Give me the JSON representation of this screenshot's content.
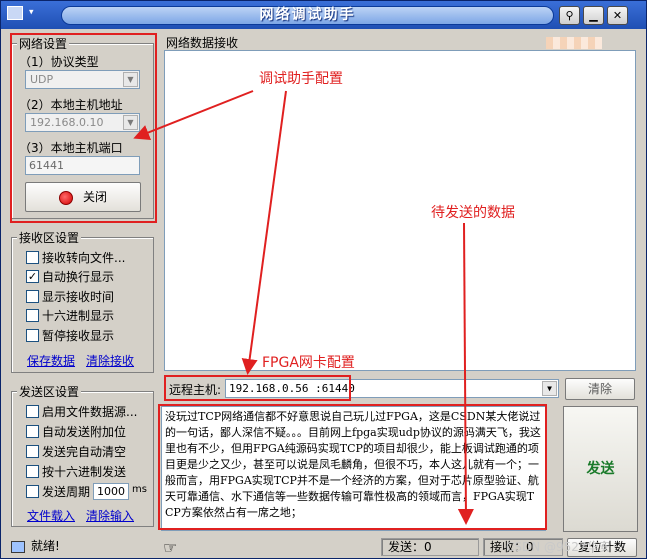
{
  "window": {
    "title": "网络调试助手",
    "pin_glyph": "⚲",
    "min_glyph": "▁",
    "close_glyph": "✕",
    "sysmenu_glyph": "▾"
  },
  "network_settings": {
    "title": "网络设置",
    "protocol_label": "（1）协议类型",
    "protocol_value": "UDP",
    "host_ip_label": "（2）本地主机地址",
    "host_ip_value": "192.168.0.10",
    "host_port_label": "（3）本地主机端口",
    "host_port_value": "61441",
    "close_button": "关闭"
  },
  "receive_settings": {
    "title": "接收区设置",
    "options": [
      {
        "label": "接收转向文件...",
        "checked": false
      },
      {
        "label": "自动换行显示",
        "checked": true
      },
      {
        "label": "显示接收时间",
        "checked": false
      },
      {
        "label": "十六进制显示",
        "checked": false
      },
      {
        "label": "暂停接收显示",
        "checked": false
      }
    ],
    "save_link": "保存数据",
    "clear_link": "清除接收"
  },
  "send_settings": {
    "title": "发送区设置",
    "options": [
      {
        "label": "启用文件数据源...",
        "checked": false
      },
      {
        "label": "自动发送附加位",
        "checked": false
      },
      {
        "label": "发送完自动清空",
        "checked": false
      },
      {
        "label": "按十六进制发送",
        "checked": false
      },
      {
        "label": "发送周期",
        "checked": false
      }
    ],
    "period_value": "1000",
    "period_unit": "ms",
    "load_link": "文件载入",
    "clear_link": "清除输入"
  },
  "receive_area": {
    "title": "网络数据接收"
  },
  "remote": {
    "label": "远程主机:",
    "value": "192.168.0.56 :61440",
    "clear_button": "清除"
  },
  "send_area": {
    "text": "没玩过TCP网络通信都不好意思说自己玩儿过FPGA，这是CSDN某大佬说过的一句话，鄙人深信不疑。。。目前网上fpga实现udp协议的源码满天飞，我这里也有不少，但用FPGA纯源码实现TCP的项目却很少，能上板调试跑通的项目更是少之又少，甚至可以说是凤毛麟角，但很不巧，本人这儿就有一个；一般而言，用FPGA实现TCP并不是一个经济的方案，但对于芯片原型验证、航天可靠通信、水下通信等一些数据传输可靠性极高的领域而言，FPGA实现TCP方案依然占有一席之地；",
    "send_button": "发送"
  },
  "status": {
    "ready": "就绪!",
    "sent": "发送：0",
    "received": "接收：0",
    "reset_button": "复位计数"
  },
  "annotations": {
    "config_note": "调试助手配置",
    "data_note": "待发送的数据",
    "fpga_note": "FPGA网卡配置",
    "color": "#e02020"
  },
  "watermark": "CSDN @9527华安"
}
